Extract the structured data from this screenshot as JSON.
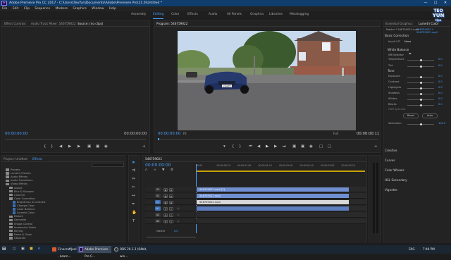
{
  "window": {
    "title": "Adobe Premiere Pro CC 2017 - C:\\Users\\TeoYun\\Documents\\Adobe\\Premiere Pro\\11.0\\Untitled *",
    "app_logo": "Pr"
  },
  "menu": [
    "File",
    "Edit",
    "Clip",
    "Sequence",
    "Markers",
    "Graphics",
    "Window",
    "Help"
  ],
  "workspaces": [
    {
      "label": "Assembly",
      "active": false
    },
    {
      "label": "Editing",
      "active": true
    },
    {
      "label": "Color",
      "active": false
    },
    {
      "label": "Effects",
      "active": false
    },
    {
      "label": "Audio",
      "active": false
    },
    {
      "label": "All Panels",
      "active": false
    },
    {
      "label": "Graphics",
      "active": false
    },
    {
      "label": "Libraries",
      "active": false
    },
    {
      "label": "Metalogging",
      "active": false
    }
  ],
  "source_panel": {
    "tabs": [
      "Effect Controls",
      "Audio Track Mixer: 546759022",
      "Source: (no clips)"
    ],
    "tc_left": "00:00:00:00",
    "tc_right": "00:00:00:00"
  },
  "program_panel": {
    "tab": "Program: 546759022",
    "tc_left": "00:00:00:00",
    "fit": "Fit",
    "quality": "Full",
    "tc_right": "00:00:00:11",
    "plate": "L33 KTT"
  },
  "effects_panel": {
    "tabs": [
      "Project: Untitled",
      "Effects"
    ],
    "tree": [
      {
        "label": "Presets",
        "indent": 0,
        "folder": true
      },
      {
        "label": "Lumetri Presets",
        "indent": 0,
        "folder": true
      },
      {
        "label": "Audio Effects",
        "indent": 0,
        "folder": true
      },
      {
        "label": "Audio Transitions",
        "indent": 0,
        "folder": true
      },
      {
        "label": "Video Effects",
        "indent": 0,
        "folder": true
      },
      {
        "label": "Adjust",
        "indent": 1,
        "folder": true
      },
      {
        "label": "Blur & Sharpen",
        "indent": 1,
        "folder": true
      },
      {
        "label": "Channel",
        "indent": 1,
        "folder": true
      },
      {
        "label": "Color Correction",
        "indent": 1,
        "folder": true
      },
      {
        "label": "Brightness & Contrast",
        "indent": 2,
        "folder": false
      },
      {
        "label": "Change Color",
        "indent": 2,
        "folder": false
      },
      {
        "label": "Color Balance",
        "indent": 2,
        "folder": false
      },
      {
        "label": "Lumetri Color",
        "indent": 2,
        "folder": false
      },
      {
        "label": "Distort",
        "indent": 1,
        "folder": true
      },
      {
        "label": "Generate",
        "indent": 1,
        "folder": true
      },
      {
        "label": "Image Control",
        "indent": 1,
        "folder": true
      },
      {
        "label": "Immersive Video",
        "indent": 1,
        "folder": true
      },
      {
        "label": "Keying",
        "indent": 1,
        "folder": true
      },
      {
        "label": "Noise & Grain",
        "indent": 1,
        "folder": true
      },
      {
        "label": "Obsolete",
        "indent": 1,
        "folder": true
      }
    ]
  },
  "timeline": {
    "tab": "546759022",
    "tc": "00:00:00:00",
    "ruler": [
      "00:00",
      "00:00:00:15",
      "00:00:01:00",
      "00:00:01:15",
      "00:00:02:00",
      "00:00:02:15",
      "00:00:03:00",
      "00:00:03:15"
    ],
    "tracks": [
      {
        "name": "V3",
        "kind": "video"
      },
      {
        "name": "V2",
        "kind": "video"
      },
      {
        "name": "V1",
        "kind": "video"
      },
      {
        "name": "A1",
        "kind": "audio"
      },
      {
        "name": "A2",
        "kind": "audio"
      },
      {
        "name": "A3",
        "kind": "audio"
      }
    ],
    "master": "Master",
    "master_val": "0.0",
    "clips": [
      {
        "label": "546759022.mp4 [V]",
        "track": 0,
        "color": "#6f8fd0"
      },
      {
        "label": "546759022.mp4",
        "track": 1,
        "color": "#6f8fd0"
      },
      {
        "label": "546759022.mp4",
        "track": 2,
        "color": "#d8d8d8"
      },
      {
        "label": "",
        "track": 3,
        "color": "#5d7fc0"
      }
    ]
  },
  "lumetri": {
    "tabs": [
      "Essential Graphics",
      "Lumetri Color"
    ],
    "clip": "Master * 546759022.mp4",
    "seq": "546759022 * 546759022.mp4",
    "basic": "Basic Correction",
    "input_lut_label": "Input LUT",
    "input_lut": "None",
    "wb": "White Balance",
    "wb_selector": "WB Selector",
    "temp": {
      "label": "Temperature",
      "value": "0.0",
      "pos": 0.5
    },
    "tint": {
      "label": "Tint",
      "value": "0.0",
      "pos": 0.5
    },
    "tone": "Tone",
    "tone_rows": [
      {
        "label": "Exposure",
        "value": "0.0",
        "pos": 0.5
      },
      {
        "label": "Contrast",
        "value": "0.0",
        "pos": 0.5
      },
      {
        "label": "Highlights",
        "value": "0.0",
        "pos": 0.5
      },
      {
        "label": "Shadows",
        "value": "0.0",
        "pos": 0.5
      },
      {
        "label": "Whites",
        "value": "0.0",
        "pos": 0.5
      },
      {
        "label": "Blacks",
        "value": "0.0",
        "pos": 0.5
      }
    ],
    "hdr": "HDR Specular",
    "reset": "Reset",
    "auto": "Auto",
    "saturation": {
      "label": "Saturation",
      "value": "100.0",
      "pos": 0.5
    },
    "sections": [
      "Creative",
      "Curves",
      "Color Wheels",
      "HSL Secondary",
      "Vignette"
    ]
  },
  "taskbar": {
    "apps": [
      {
        "label": "CinecraftJoel - Learn...",
        "color": "#e05a2a"
      },
      {
        "label": "Adobe Premiere Pro C...",
        "color": "#2a0e4e"
      },
      {
        "label": "OBS 20.1.3 (64bit, win...",
        "color": "#333"
      }
    ],
    "time": "7:44 PM",
    "lang": "ENG"
  },
  "watermark": {
    "line1": "TEO",
    "line2": "YUN",
    "line3": "tips"
  }
}
